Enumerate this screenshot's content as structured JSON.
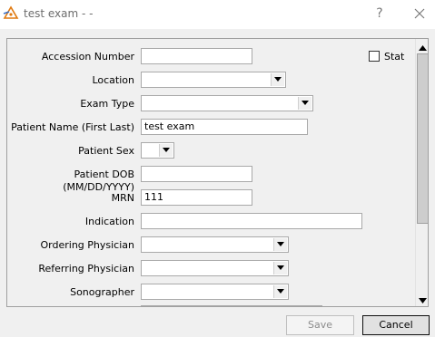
{
  "window": {
    "title": "test exam -  -",
    "help_glyph": "?",
    "app_icon": "app-triangle-icon",
    "close_icon": "close-icon"
  },
  "form": {
    "accession_number": {
      "label": "Accession Number",
      "value": ""
    },
    "stat": {
      "label": "Stat",
      "checked": false
    },
    "location": {
      "label": "Location",
      "value": ""
    },
    "exam_type": {
      "label": "Exam Type",
      "value": ""
    },
    "patient_name": {
      "label": "Patient Name (First Last)",
      "value": "test exam"
    },
    "patient_sex": {
      "label": "Patient Sex",
      "value": ""
    },
    "patient_dob": {
      "label": "Patient DOB (MM/DD/YYYY)",
      "value": ""
    },
    "mrn": {
      "label": "MRN",
      "value": "111"
    },
    "indication": {
      "label": "Indication",
      "value": ""
    },
    "ordering_physician": {
      "label": "Ordering Physician",
      "value": ""
    },
    "referring_physician": {
      "label": "Referring Physician",
      "value": ""
    },
    "sonographer": {
      "label": "Sonographer",
      "value": ""
    }
  },
  "buttons": {
    "save": {
      "label": "Save",
      "enabled": false
    },
    "cancel": {
      "label": "Cancel",
      "enabled": true
    }
  },
  "colors": {
    "title_text": "#6d6d6d",
    "disabled_text": "#8c8c8c",
    "icon_orange": "#e07a10",
    "icon_blue": "#3b6fc4"
  }
}
